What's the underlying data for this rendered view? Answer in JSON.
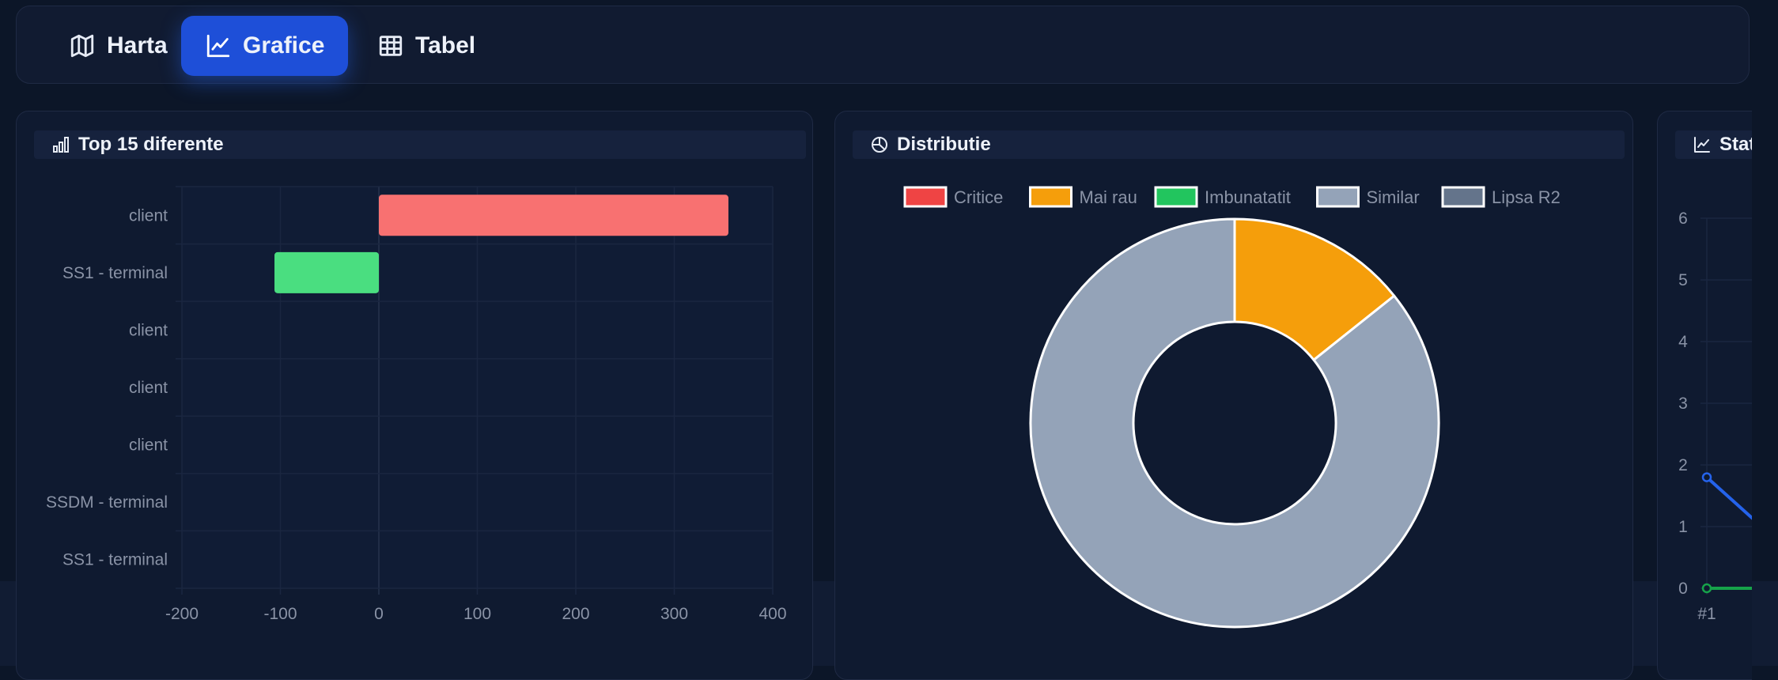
{
  "tabs": [
    {
      "label": "Harta",
      "icon": "map-icon",
      "active": false
    },
    {
      "label": "Grafice",
      "icon": "line-chart-icon",
      "active": true
    },
    {
      "label": "Tabel",
      "icon": "table-icon",
      "active": false
    }
  ],
  "cards": {
    "top": {
      "title": "Top 15 diferente",
      "icon": "bar-chart-icon"
    },
    "dist": {
      "title": "Distributie",
      "icon": "pie-chart-icon"
    },
    "stat": {
      "title": "Statistici",
      "icon": "line-chart-icon"
    }
  },
  "colors": {
    "accent": "#1e4fd8",
    "positive": "#f87171",
    "negative": "#4ade80"
  },
  "chart_data": [
    {
      "type": "bar",
      "orientation": "horizontal",
      "title": "Top 15 diferente",
      "categories": [
        "client",
        "SS1 - terminal",
        "client",
        "client",
        "client",
        "SSDM - terminal",
        "SS1 - terminal"
      ],
      "values": [
        355,
        -106,
        0,
        0,
        0,
        0,
        0
      ],
      "xlim": [
        -200,
        400
      ],
      "xticks": [
        "-200",
        "-100",
        "0",
        "100",
        "200",
        "300",
        "400"
      ],
      "grid": true
    },
    {
      "type": "pie",
      "subtype": "doughnut",
      "title": "Distributie",
      "legend_position": "top",
      "labels": [
        "Critice",
        "Mai rau",
        "Imbunatatit",
        "Similar",
        "Lipsa R2"
      ],
      "colors": [
        "#ef4444",
        "#f59e0b",
        "#22c55e",
        "#94a3b8",
        "#64748b"
      ],
      "values": [
        0,
        1,
        0,
        6,
        0
      ]
    },
    {
      "type": "line",
      "title": "Statistici",
      "x": [
        "#1"
      ],
      "ylim": [
        0,
        6
      ],
      "yticks": [
        "0",
        "1",
        "2",
        "3",
        "4",
        "5",
        "6"
      ],
      "series": [
        {
          "color": "#2563eb",
          "values": [
            1.8
          ]
        },
        {
          "color": "#16a34a",
          "values": [
            0
          ]
        }
      ]
    }
  ]
}
